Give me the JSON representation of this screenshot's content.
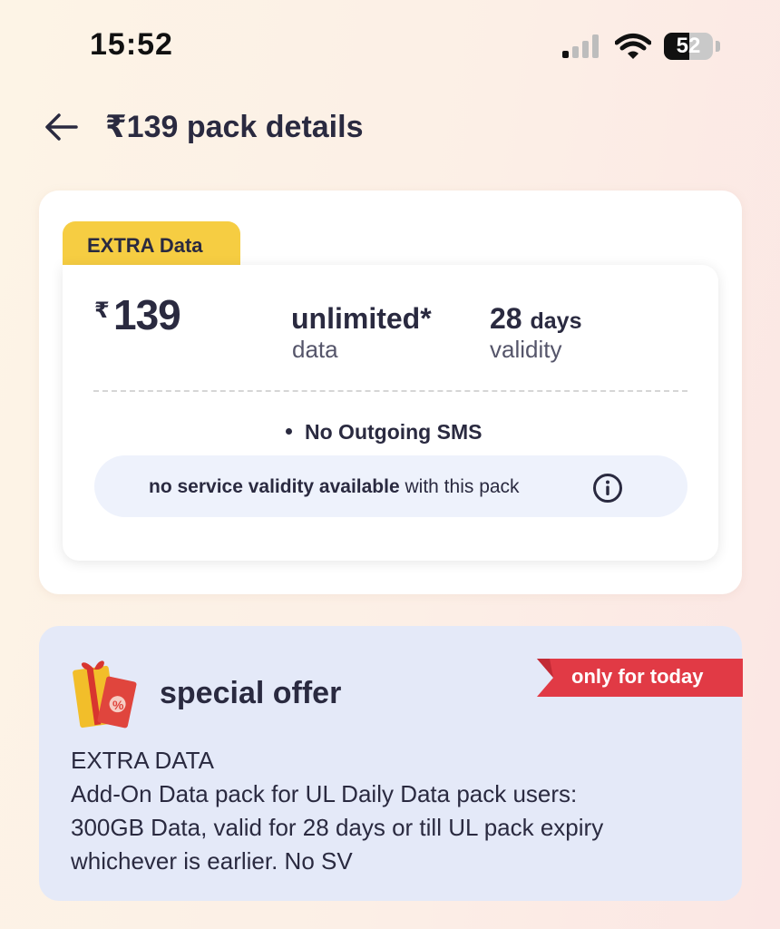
{
  "status_bar": {
    "time": "15:52",
    "battery": "52",
    "battery_level": 0.52
  },
  "header": {
    "title": "₹139 pack details"
  },
  "pack": {
    "tag": "EXTRA Data",
    "currency": "₹",
    "price": "139",
    "data_value": "unlimited*",
    "data_label": "data",
    "validity_value": "28",
    "validity_unit": "days",
    "validity_label": "validity",
    "benefits": [
      "No Outgoing SMS"
    ],
    "sv_notice_bold": "no service validity available",
    "sv_notice_rest": "with this pack"
  },
  "offer": {
    "title": "special offer",
    "badge": "only for today",
    "description": [
      "EXTRA DATA",
      "Add-On Data pack for UL Daily Data pack users:",
      "300GB Data, valid for 28 days or till UL pack expiry",
      "whichever is earlier. No SV"
    ]
  },
  "colors": {
    "tag_yellow": "#f6cd42",
    "offer_bg": "#e4e9f8",
    "ribbon_red": "#e13a45",
    "sv_pill_bg": "#eef2fc"
  },
  "icons": [
    "cellular-signal-icon",
    "wifi-icon",
    "battery-icon",
    "back-arrow-icon",
    "info-icon",
    "gift-icon"
  ]
}
